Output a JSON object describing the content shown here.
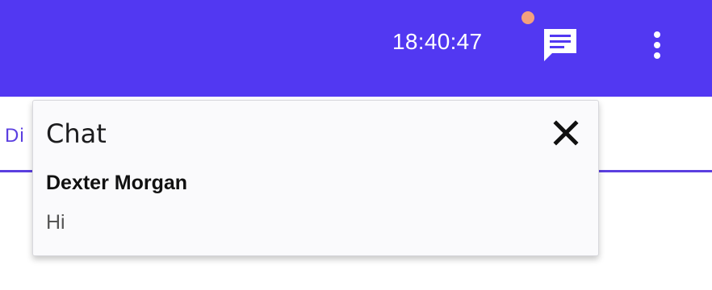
{
  "header": {
    "clock": "18:40:47",
    "background_color": "#5238f2",
    "notification_dot_color": "#f3a07e",
    "chat_icon": "chat-bubble-icon",
    "more_icon": "more-vert-icon"
  },
  "tabs": {
    "partial_label": "Di",
    "accent_color": "#5b3fe0"
  },
  "chat_panel": {
    "title": "Chat",
    "close_icon": "close-icon",
    "messages": [
      {
        "sender": "Dexter Morgan",
        "text": "Hi"
      }
    ]
  }
}
